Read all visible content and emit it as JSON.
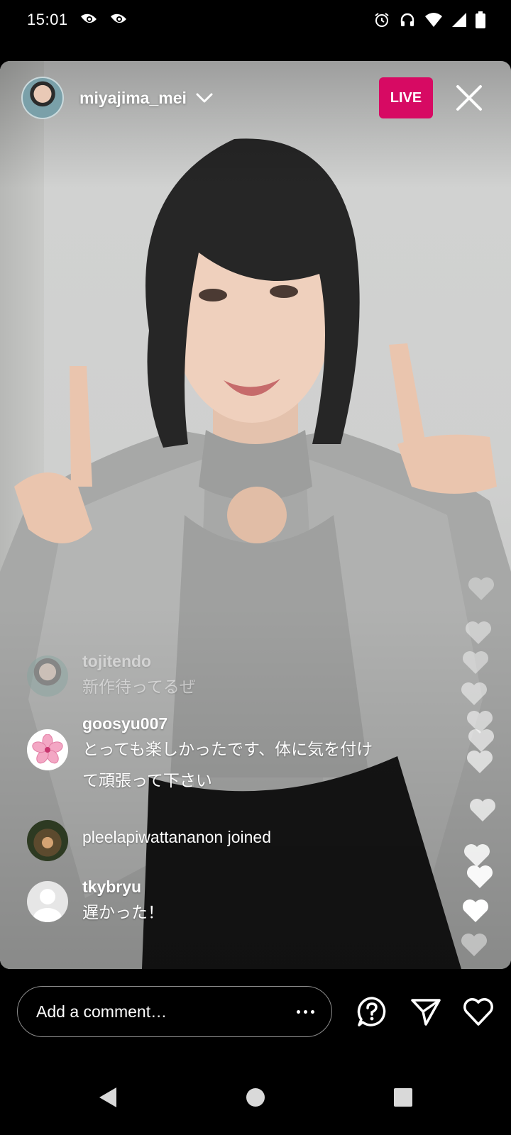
{
  "status_bar": {
    "time": "15:01",
    "left_icons": [
      "eye-notification-icon",
      "eye-notification-icon"
    ],
    "right_icons": [
      "alarm-icon",
      "headphones-icon",
      "wifi-icon",
      "signal-icon",
      "battery-icon"
    ]
  },
  "live": {
    "username": "miyajima_mei",
    "live_badge": "LIVE",
    "accent_color": "#d70a63"
  },
  "comments": [
    {
      "username": "tojitendo",
      "text": "新作待ってるぜ",
      "avatar": "user-photo",
      "faded": true
    },
    {
      "username": "goosyu007",
      "text_line1": "とっても楽しかったです、体に気を付け",
      "text_line2": "て頑張って下さい",
      "avatar": "sakura-flower"
    },
    {
      "joined_text": "pleelapiwattananon joined",
      "avatar": "user-photo"
    },
    {
      "username": "tkybryu",
      "text": "遅かった！",
      "avatar": "default-user"
    }
  ],
  "bottom_bar": {
    "comment_placeholder": "Add a comment…",
    "icons": [
      "more-icon",
      "question-icon",
      "send-icon",
      "heart-icon"
    ]
  },
  "nav_bar": {
    "icons": [
      "back-icon",
      "home-icon",
      "recents-icon"
    ]
  }
}
